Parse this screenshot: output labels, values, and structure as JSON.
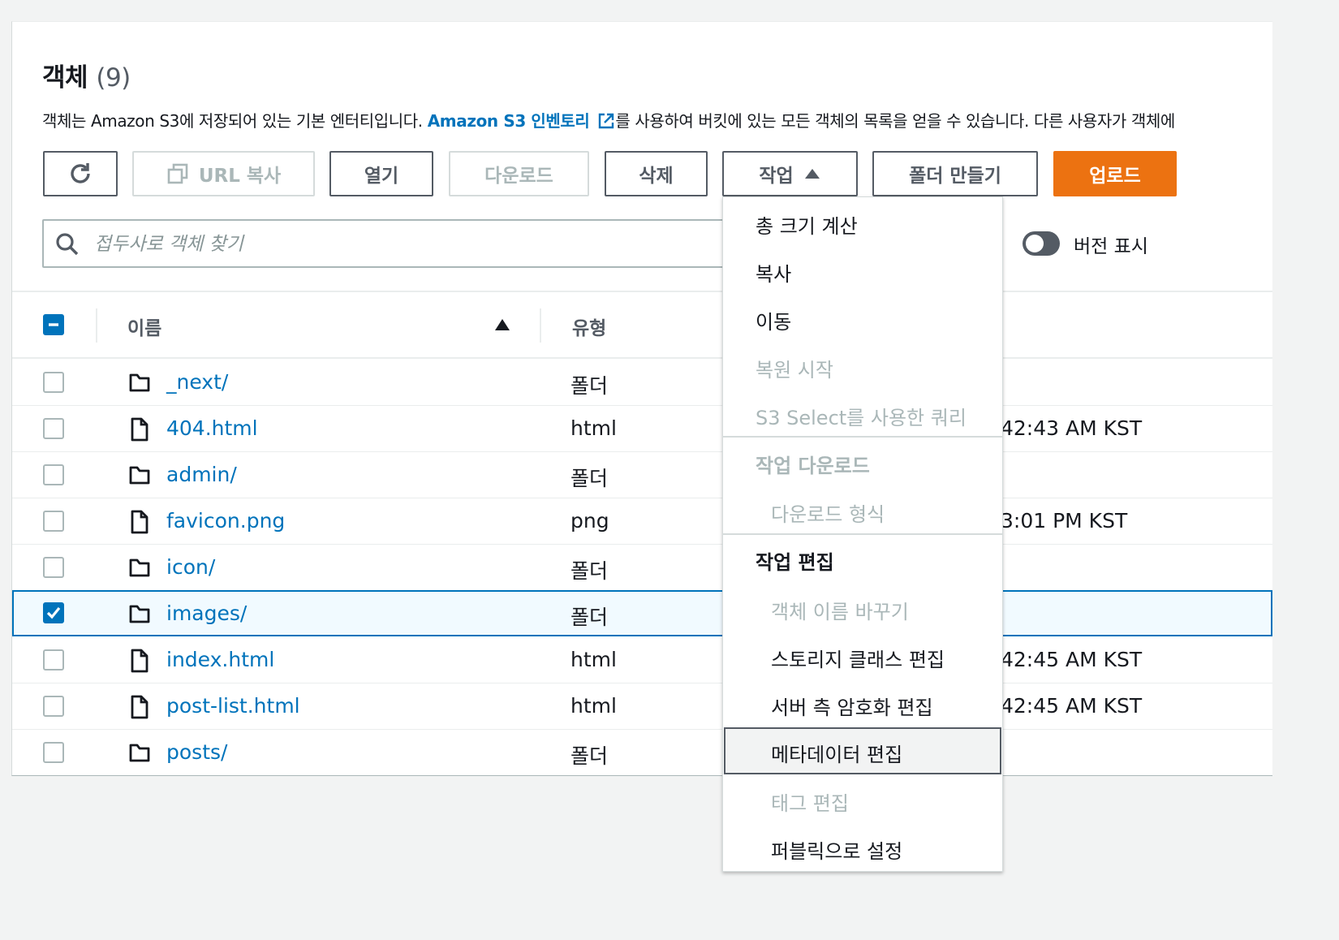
{
  "panel": {
    "title": "객체",
    "count": "(9)",
    "description_pre": "객체는 Amazon S3에 저장되어 있는 기본 엔터티입니다. ",
    "description_link": "Amazon S3 인벤토리",
    "description_post": "를 사용하여 버킷에 있는 모든 객체의 목록을 얻을 수 있습니다. 다른 사용자가 객체에"
  },
  "toolbar": {
    "copy_url_label": "URL 복사",
    "open_label": "열기",
    "download_label": "다운로드",
    "delete_label": "삭제",
    "actions_label": "작업",
    "create_folder_label": "폴더 만들기",
    "upload_label": "업로드"
  },
  "search": {
    "placeholder": "접두사로 객체 찾기"
  },
  "version_toggle": {
    "label": "버전 표시",
    "on": false
  },
  "table": {
    "columns": {
      "name": "이름",
      "type": "유형"
    },
    "rows": [
      {
        "name": "_next/",
        "type": "폴더",
        "kind": "folder",
        "date": "",
        "checked": false
      },
      {
        "name": "404.html",
        "type": "html",
        "kind": "file",
        "date": "42:43 AM KST",
        "checked": false
      },
      {
        "name": "admin/",
        "type": "폴더",
        "kind": "folder",
        "date": "",
        "checked": false
      },
      {
        "name": "favicon.png",
        "type": "png",
        "kind": "file",
        "date": "3:01 PM KST",
        "checked": false
      },
      {
        "name": "icon/",
        "type": "폴더",
        "kind": "folder",
        "date": "",
        "checked": false
      },
      {
        "name": "images/",
        "type": "폴더",
        "kind": "folder",
        "date": "",
        "checked": true
      },
      {
        "name": "index.html",
        "type": "html",
        "kind": "file",
        "date": "42:45 AM KST",
        "checked": false
      },
      {
        "name": "post-list.html",
        "type": "html",
        "kind": "file",
        "date": "42:45 AM KST",
        "checked": false
      },
      {
        "name": "posts/",
        "type": "폴더",
        "kind": "folder",
        "date": "",
        "checked": false
      }
    ]
  },
  "actions_menu": {
    "calc_size": "총 크기 계산",
    "copy": "복사",
    "move": "이동",
    "restore": "복원 시작",
    "s3_select": "S3 Select를 사용한 쿼리",
    "download_group": "작업 다운로드",
    "download_format": "다운로드 형식",
    "edit_group": "작업 편집",
    "rename": "객체 이름 바꾸기",
    "storage_class": "스토리지 클래스 편집",
    "encryption": "서버 측 암호화 편집",
    "metadata": "메타데이터 편집",
    "tags": "태그 편집",
    "make_public": "퍼블릭으로 설정"
  },
  "colors": {
    "accent": "#0073bb",
    "primary_button": "#ec7211"
  }
}
